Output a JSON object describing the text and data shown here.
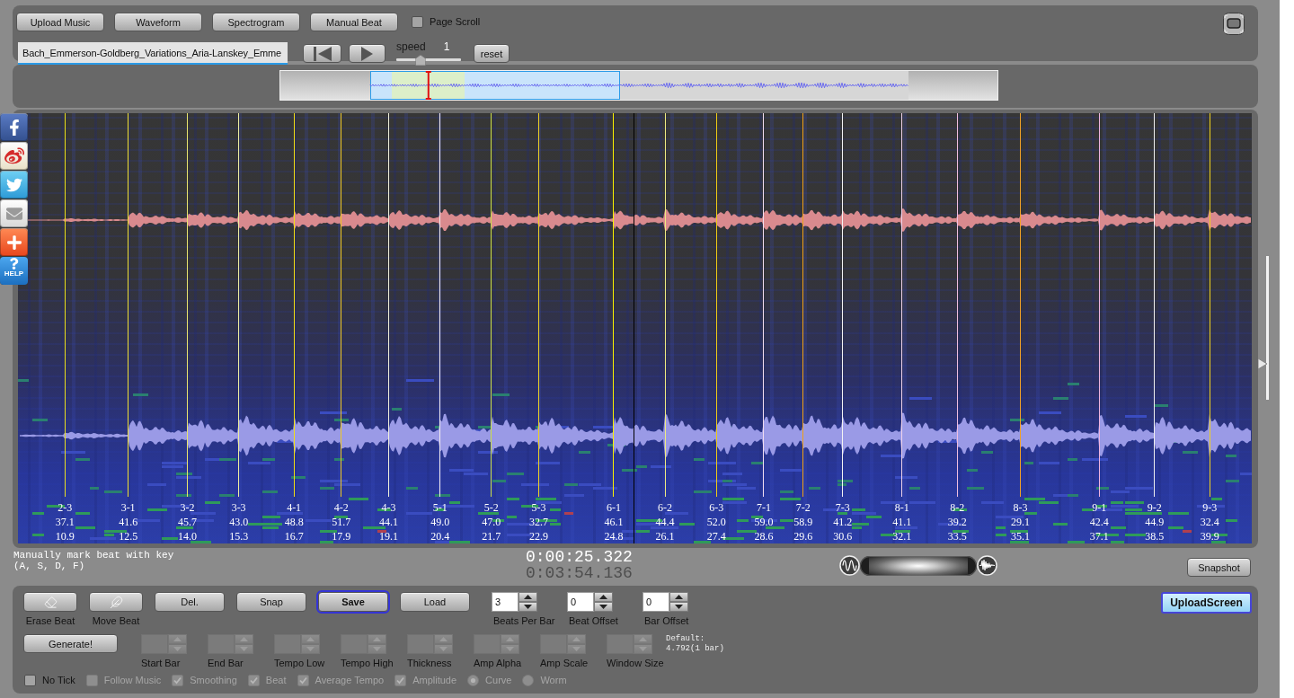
{
  "toolbar": {
    "buttons": [
      {
        "label": "Upload Music"
      },
      {
        "label": "Waveform"
      },
      {
        "label": "Spectrogram"
      },
      {
        "label": "Manual Beat"
      }
    ],
    "page_scroll": {
      "label": "Page Scroll",
      "checked": false
    }
  },
  "player": {
    "file_name": "Bach_Emmerson-Goldberg_Variations_Aria-Lanskey_Emme",
    "speed": {
      "label": "speed",
      "value": "1",
      "level": 0.38
    },
    "reset": "reset"
  },
  "social": {
    "help_label": "HELP"
  },
  "spectrogram": {
    "beats": [
      {
        "label": "2-3",
        "tempo": "37.1",
        "time": "10.9",
        "color": "#e6dc1e"
      },
      {
        "label": "3-1",
        "tempo": "41.6",
        "time": "12.5",
        "color": "#f0e032"
      },
      {
        "label": "3-2",
        "tempo": "45.7",
        "time": "14.0",
        "color": "#e8e46e"
      },
      {
        "label": "3-3",
        "tempo": "43.0",
        "time": "15.3",
        "color": "#eeeea0"
      },
      {
        "label": "4-1",
        "tempo": "48.8",
        "time": "16.7",
        "color": "#f2de14"
      },
      {
        "label": "4-2",
        "tempo": "51.7",
        "time": "17.9",
        "color": "#f0c81e"
      },
      {
        "label": "4-3",
        "tempo": "44.1",
        "time": "19.1",
        "color": "#f0f0dc"
      },
      {
        "label": "5-1",
        "tempo": "49.0",
        "time": "20.4",
        "color": "#f4ecf0"
      },
      {
        "label": "5-2",
        "tempo": "47.0",
        "time": "21.7",
        "color": "#cce046"
      },
      {
        "label": "5-3",
        "tempo": "32.7",
        "time": "22.9",
        "color": "#f0d21e"
      },
      {
        "label": "6-1",
        "tempo": "46.1",
        "time": "24.8",
        "color": "#f8f000"
      },
      {
        "label": "6-2",
        "tempo": "44.4",
        "time": "26.1",
        "color": "#eeea82"
      },
      {
        "label": "6-3",
        "tempo": "52.0",
        "time": "27.4",
        "color": "#f0cc14"
      },
      {
        "label": "7-1",
        "tempo": "59.0",
        "time": "28.6",
        "color": "#f0dcf0"
      },
      {
        "label": "7-2",
        "tempo": "58.9",
        "time": "29.6",
        "color": "#f0a014"
      },
      {
        "label": "7-3",
        "tempo": "41.2",
        "time": "30.6",
        "color": "#f4f4f4"
      },
      {
        "label": "8-1",
        "tempo": "41.1",
        "time": "32.1",
        "color": "#f0d4ec"
      },
      {
        "label": "8-2",
        "tempo": "39.2",
        "time": "33.5",
        "color": "#f0bee0"
      },
      {
        "label": "8-3",
        "tempo": "29.1",
        "time": "35.1",
        "color": "#f0a028"
      },
      {
        "label": "9-1",
        "tempo": "42.4",
        "time": "37.1",
        "color": "#f0b4e0"
      },
      {
        "label": "9-2",
        "tempo": "44.9",
        "time": "38.5",
        "color": "#f0f0f0"
      },
      {
        "label": "9-3",
        "tempo": "32.4",
        "time": "39.9",
        "color": "#f0d21e"
      }
    ]
  },
  "status": {
    "hint": "Manually mark beat with key\n(A, S, D, F)",
    "current_time": "0:00:25.322",
    "total_time": "0:03:54.136",
    "blend_slider": {
      "level": 0.5
    },
    "snapshot": "Snapshot"
  },
  "beat_editor": {
    "row_1": [
      {
        "kind": "tool",
        "label": "Erase Beat"
      },
      {
        "kind": "tool",
        "label": "Move Beat"
      },
      {
        "kind": "button",
        "label": "Del.",
        "focused": false
      },
      {
        "kind": "button",
        "label": "Snap",
        "focused": false
      },
      {
        "kind": "button",
        "label": "Save",
        "focused": true
      },
      {
        "kind": "button",
        "label": "Load",
        "focused": false
      },
      {
        "kind": "spinner",
        "label": "Beats Per Bar",
        "value": "3"
      },
      {
        "kind": "spinner",
        "label": "Beat Offset",
        "value": "0"
      },
      {
        "kind": "spinner",
        "label": "Bar Offset",
        "value": "0"
      }
    ],
    "upload_screen": "UploadScreen",
    "generate": "Generate!",
    "parameters": [
      {
        "label": "Start Bar",
        "disabled": true
      },
      {
        "label": "End Bar",
        "disabled": true
      },
      {
        "label": "Tempo Low",
        "disabled": true
      },
      {
        "label": "Tempo High",
        "disabled": true
      },
      {
        "label": "Thickness",
        "disabled": true
      },
      {
        "label": "Amp Alpha",
        "disabled": true
      },
      {
        "label": "Amp Scale",
        "disabled": true
      },
      {
        "label": "Window Size",
        "disabled": true
      }
    ],
    "default_note": "Default:\n4.792(1 bar)",
    "options": [
      {
        "kind": "checkbox",
        "label": "No Tick",
        "checked": false,
        "disabled": false
      },
      {
        "kind": "checkbox",
        "label": "Follow Music",
        "checked": false,
        "disabled": true
      },
      {
        "kind": "checkbox",
        "label": "Smoothing",
        "checked": true,
        "disabled": true
      },
      {
        "kind": "checkbox",
        "label": "Beat",
        "checked": true,
        "disabled": true
      },
      {
        "kind": "checkbox",
        "label": "Average Tempo",
        "checked": true,
        "disabled": true
      },
      {
        "kind": "checkbox",
        "label": "Amplitude",
        "checked": true,
        "disabled": true
      },
      {
        "kind": "radio",
        "label": "Curve",
        "selected": true,
        "disabled": true
      },
      {
        "kind": "radio",
        "label": "Worm",
        "selected": false,
        "disabled": true
      }
    ]
  }
}
